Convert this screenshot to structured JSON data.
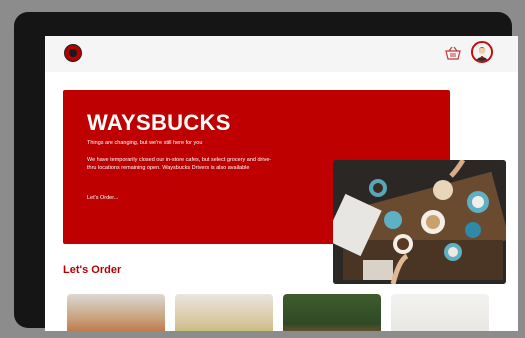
{
  "navbar": {
    "logo_icon": "waysbucks-logo-icon",
    "cart_icon": "basket-icon",
    "avatar_icon": "user-avatar-icon"
  },
  "hero": {
    "title": "WAYSBUCKS",
    "subtitle": "Things are changing, but we're still here for you",
    "description": "We have temporarily closed our in-store cafes, but select grocery and drive-thru locations remaining open. Waysbucks Drivers is also available",
    "link": "Let's Order..."
  },
  "section": {
    "title": "Let's Order"
  },
  "colors": {
    "brand_red": "#be0000",
    "accent_red": "#b30000"
  }
}
